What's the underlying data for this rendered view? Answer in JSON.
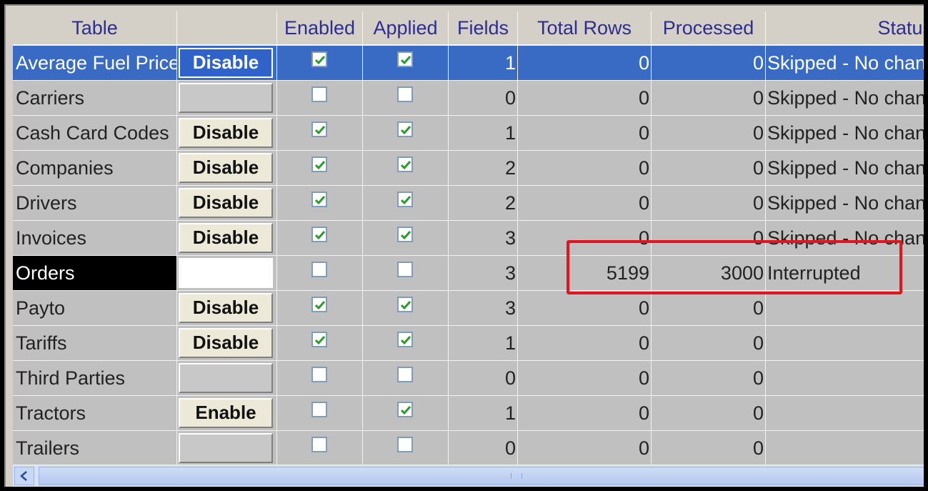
{
  "headers": {
    "table": "Table",
    "action": "",
    "enabled": "Enabled",
    "applied": "Applied",
    "fields": "Fields",
    "total_rows": "Total Rows",
    "processed": "Processed",
    "status": "Status"
  },
  "rows": [
    {
      "name": "Average Fuel Prices",
      "button": "Disable",
      "enabled": true,
      "applied": true,
      "fields": "1",
      "total_rows": "0",
      "processed": "0",
      "status": "Skipped - No changes"
    },
    {
      "name": "Carriers",
      "button": "",
      "enabled": false,
      "applied": false,
      "fields": "0",
      "total_rows": "0",
      "processed": "0",
      "status": "Skipped - No changes"
    },
    {
      "name": "Cash Card Codes",
      "button": "Disable",
      "enabled": true,
      "applied": true,
      "fields": "1",
      "total_rows": "0",
      "processed": "0",
      "status": "Skipped - No changes"
    },
    {
      "name": "Companies",
      "button": "Disable",
      "enabled": true,
      "applied": true,
      "fields": "2",
      "total_rows": "0",
      "processed": "0",
      "status": "Skipped - No changes"
    },
    {
      "name": "Drivers",
      "button": "Disable",
      "enabled": true,
      "applied": true,
      "fields": "2",
      "total_rows": "0",
      "processed": "0",
      "status": "Skipped - No changes"
    },
    {
      "name": "Invoices",
      "button": "Disable",
      "enabled": true,
      "applied": true,
      "fields": "3",
      "total_rows": "0",
      "processed": "0",
      "status": "Skipped - No changes"
    },
    {
      "name": "Orders",
      "button": "",
      "enabled": false,
      "applied": false,
      "fields": "3",
      "total_rows": "5199",
      "processed": "3000",
      "status": "Interrupted"
    },
    {
      "name": "Payto",
      "button": "Disable",
      "enabled": true,
      "applied": true,
      "fields": "3",
      "total_rows": "0",
      "processed": "0",
      "status": ""
    },
    {
      "name": "Tariffs",
      "button": "Disable",
      "enabled": true,
      "applied": true,
      "fields": "1",
      "total_rows": "0",
      "processed": "0",
      "status": ""
    },
    {
      "name": "Third Parties",
      "button": "",
      "enabled": false,
      "applied": false,
      "fields": "0",
      "total_rows": "0",
      "processed": "0",
      "status": ""
    },
    {
      "name": "Tractors",
      "button": "Enable",
      "enabled": false,
      "applied": true,
      "fields": "1",
      "total_rows": "0",
      "processed": "0",
      "status": ""
    },
    {
      "name": "Trailers",
      "button": "",
      "enabled": false,
      "applied": false,
      "fields": "0",
      "total_rows": "0",
      "processed": "0",
      "status": ""
    }
  ],
  "selected_row": "Average Fuel Prices",
  "colors": {
    "header_text": "#2d2d8f",
    "selection": "#3a6bc4",
    "highlight_box": "#e3141e",
    "check": "#2a9a2a"
  },
  "icons": {
    "scroll_left": "chevron-left-icon",
    "check": "checkmark-icon"
  }
}
